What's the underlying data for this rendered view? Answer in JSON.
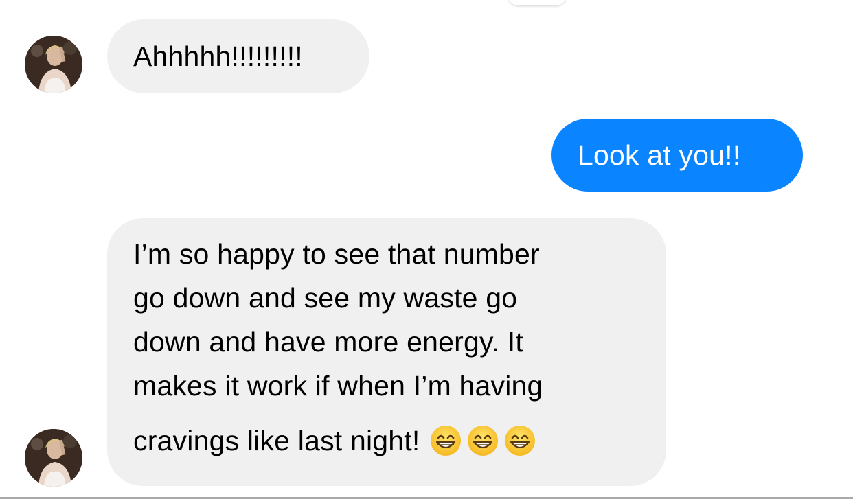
{
  "thread": {
    "messages": [
      {
        "direction": "incoming",
        "text": "Ahhhhh!!!!!!!!!"
      },
      {
        "direction": "outgoing",
        "text": "Look at you!!"
      },
      {
        "direction": "incoming",
        "lines": [
          "I’m so happy to see that number",
          "go down and see my waste go",
          "down and have more energy. It",
          "makes it work if when I’m having",
          "cravings like last night!"
        ],
        "emojis": [
          "grinning-face-with-smiling-eyes",
          "grinning-face-with-smiling-eyes",
          "grinning-face-with-smiling-eyes"
        ]
      }
    ]
  },
  "colors": {
    "incoming_bubble": "#f0f0f0",
    "outgoing_bubble": "#0a84ff",
    "background": "#ffffff"
  }
}
